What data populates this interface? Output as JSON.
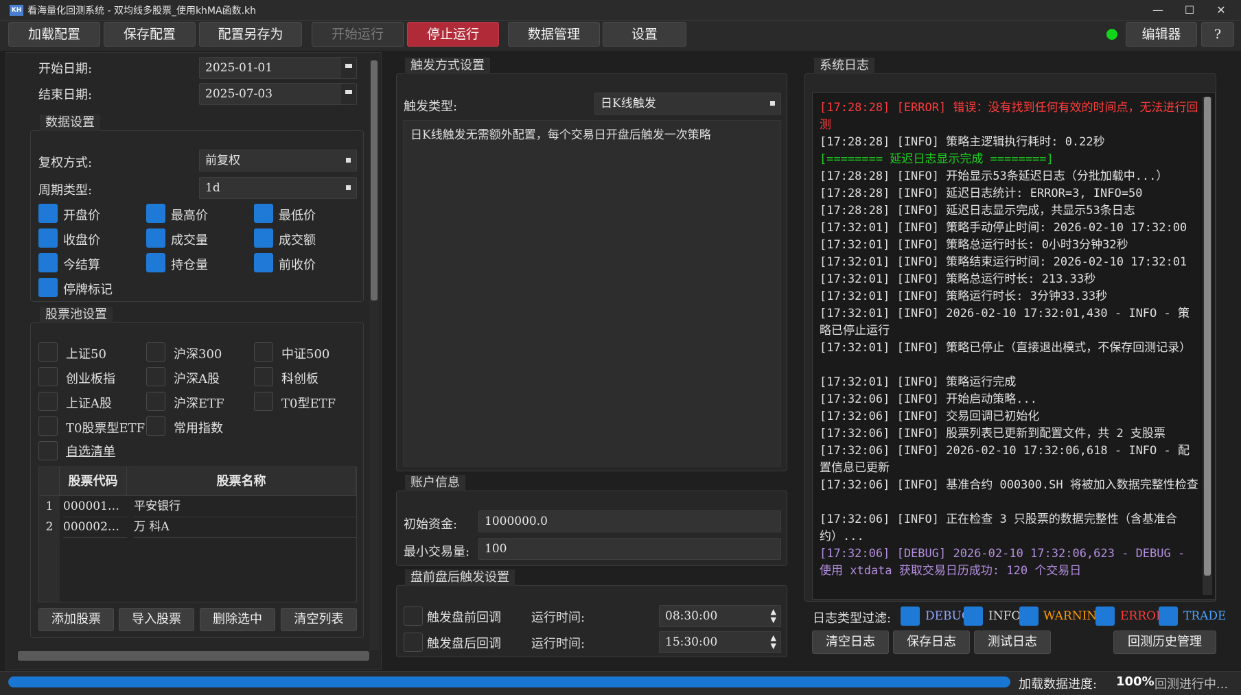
{
  "window": {
    "logo": "KH",
    "title": "看海量化回测系统 - 双均线多股票_使用khMA函数.kh",
    "minimize": "—",
    "maximize": "☐",
    "close": "✕"
  },
  "toolbar": {
    "load": "加载配置",
    "save": "保存配置",
    "save_as": "配置另存为",
    "start": "开始运行",
    "stop": "停止运行",
    "data": "数据管理",
    "settings": "设置",
    "editor": "编辑器",
    "help": "?",
    "status_color": "#11d41b"
  },
  "left": {
    "start_date_label": "开始日期:",
    "start_date": "2025-01-01",
    "end_date_label": "结束日期:",
    "end_date": "2025-07-03",
    "data_settings_title": "数据设置",
    "adjust_label": "复权方式:",
    "adjust_value": "前复权",
    "period_label": "周期类型:",
    "period_value": "1d",
    "fields": [
      {
        "label": "开盘价",
        "checked": true
      },
      {
        "label": "最高价",
        "checked": true
      },
      {
        "label": "最低价",
        "checked": true
      },
      {
        "label": "收盘价",
        "checked": true
      },
      {
        "label": "成交量",
        "checked": true
      },
      {
        "label": "成交额",
        "checked": true
      },
      {
        "label": "今结算",
        "checked": true
      },
      {
        "label": "持仓量",
        "checked": true
      },
      {
        "label": "前收价",
        "checked": true
      },
      {
        "label": "停牌标记",
        "checked": true
      }
    ],
    "pool_title": "股票池设置",
    "pools": [
      {
        "label": "上证50",
        "checked": false
      },
      {
        "label": "沪深300",
        "checked": false
      },
      {
        "label": "中证500",
        "checked": false
      },
      {
        "label": "创业板指",
        "checked": false
      },
      {
        "label": "沪深A股",
        "checked": false
      },
      {
        "label": "科创板",
        "checked": false
      },
      {
        "label": "上证A股",
        "checked": false
      },
      {
        "label": "沪深ETF",
        "checked": false
      },
      {
        "label": "T0型ETF",
        "checked": false
      },
      {
        "label": "T0股票型ETF",
        "checked": false
      },
      {
        "label": "常用指数",
        "checked": false
      }
    ],
    "custom_list": "自选清单",
    "table_headers": [
      "股票代码",
      "股票名称"
    ],
    "rows": [
      {
        "idx": "1",
        "code": "000001…",
        "name": "平安银行"
      },
      {
        "idx": "2",
        "code": "000002…",
        "name": "万 科A"
      }
    ],
    "add_btn": "添加股票",
    "import_btn": "导入股票",
    "delete_btn": "删除选中",
    "clear_btn": "清空列表"
  },
  "middle": {
    "trigger_title": "触发方式设置",
    "trigger_label": "触发类型:",
    "trigger_value": "日K线触发",
    "trigger_desc": "日K线触发无需额外配置，每个交易日开盘后触发一次策略",
    "account_title": "账户信息",
    "capital_label": "初始资金:",
    "capital_value": "1000000.0",
    "min_trade_label": "最小交易量:",
    "min_trade_value": "100",
    "prepost_title": "盘前盘后触发设置",
    "pre_label": "触发盘前回调",
    "pre_time_label": "运行时间:",
    "pre_time": "08:30:00",
    "post_label": "触发盘后回调",
    "post_time_label": "运行时间:",
    "post_time": "15:30:00"
  },
  "log": {
    "title": "系统日志",
    "lines": [
      {
        "text": "[17:28:28] [ERROR] 错误：没有找到任何有效的时间点，无法进行回测",
        "color": "#ff3b3b"
      },
      {
        "text": "[17:28:28] [INFO] 策略主逻辑执行耗时: 0.22秒",
        "color": "#e0e0e0"
      },
      {
        "text": "[======== 延迟日志显示完成 ========]",
        "color": "#19d219"
      },
      {
        "text": "[17:28:28] [INFO] 开始显示53条延迟日志（分批加载中...）",
        "color": "#e0e0e0"
      },
      {
        "text": "[17:28:28] [INFO] 延迟日志统计: ERROR=3, INFO=50",
        "color": "#e0e0e0"
      },
      {
        "text": "[17:28:28] [INFO] 延迟日志显示完成，共显示53条日志",
        "color": "#e0e0e0"
      },
      {
        "text": "[17:32:01] [INFO] 策略手动停止时间: 2026-02-10 17:32:00",
        "color": "#e0e0e0"
      },
      {
        "text": "[17:32:01] [INFO] 策略总运行时长: 0小时3分钟32秒",
        "color": "#e0e0e0"
      },
      {
        "text": "[17:32:01] [INFO] 策略结束运行时间: 2026-02-10 17:32:01",
        "color": "#e0e0e0"
      },
      {
        "text": "[17:32:01] [INFO] 策略总运行时长: 213.33秒",
        "color": "#e0e0e0"
      },
      {
        "text": "[17:32:01] [INFO] 策略运行时长: 3分钟33.33秒",
        "color": "#e0e0e0"
      },
      {
        "text": "[17:32:01] [INFO] 2026-02-10 17:32:01,430 - INFO - 策略已停止运行",
        "color": "#e0e0e0"
      },
      {
        "text": "[17:32:01] [INFO] 策略已停止（直接退出模式，不保存回测记录）",
        "color": "#e0e0e0"
      },
      {
        "text": "[17:32:01] [INFO] 策略运行完成",
        "color": "#e0e0e0"
      },
      {
        "text": "[17:32:06] [INFO] 开始启动策略...",
        "color": "#e0e0e0"
      },
      {
        "text": "[17:32:06] [INFO] 交易回调已初始化",
        "color": "#e0e0e0"
      },
      {
        "text": "[17:32:06] [INFO] 股票列表已更新到配置文件，共 2 支股票",
        "color": "#e0e0e0"
      },
      {
        "text": "[17:32:06] [INFO] 2026-02-10 17:32:06,618 - INFO - 配置信息已更新",
        "color": "#e0e0e0"
      },
      {
        "text": "[17:32:06] [INFO] 基准合约 000300.SH 将被加入数据完整性检查",
        "color": "#e0e0e0"
      },
      {
        "text": "[17:32:06] [INFO] 正在检查 3 只股票的数据完整性（含基准合约）...",
        "color": "#e0e0e0"
      },
      {
        "text": "[17:32:06] [DEBUG] 2026-02-10 17:32:06,623 - DEBUG - 使用 xtdata 获取交易日历成功: 120 个交易日",
        "color": "#b48ee0"
      }
    ],
    "filter_label": "日志类型过滤:",
    "filters": [
      {
        "label": "DEBUG",
        "color": "#8fa6ff"
      },
      {
        "label": "INFO",
        "color": "#e0e0e0"
      },
      {
        "label": "WARNING",
        "color": "#ff9d00"
      },
      {
        "label": "ERROR",
        "color": "#ff3b3b"
      },
      {
        "label": "TRADE",
        "color": "#4da6ff"
      }
    ],
    "clear_btn": "清空日志",
    "save_btn": "保存日志",
    "test_btn": "测试日志",
    "history_btn": "回测历史管理"
  },
  "status": {
    "progress_label": "加载数据进度:",
    "progress_value": "100%",
    "progress": 1.0,
    "state_text": "回测进行中..."
  }
}
